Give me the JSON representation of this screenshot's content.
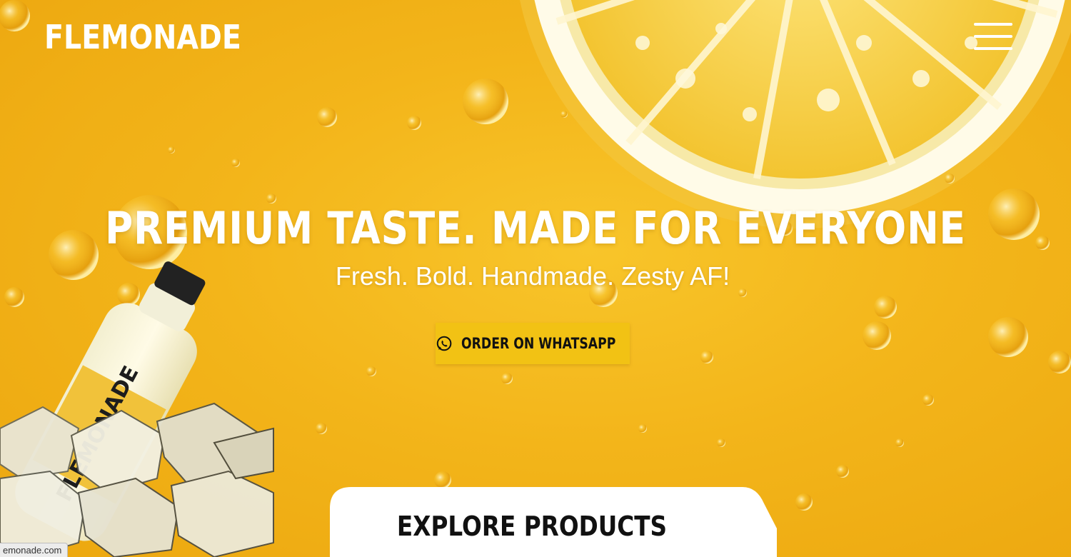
{
  "header": {
    "logo": "FLEMONADE",
    "menu_icon": "hamburger-menu-icon"
  },
  "hero": {
    "headline": "PREMIUM TASTE. MADE FOR EVERYONE",
    "subline": "Fresh. Bold. Handmade. Zesty AF!",
    "cta_label": "ORDER ON WHATSAPP",
    "cta_icon": "whatsapp-icon",
    "bottle_label": "FLEMONADE"
  },
  "products": {
    "label": "EXPLORE PRODUCTS"
  },
  "status_bar": {
    "url": "emonade.com"
  },
  "colors": {
    "background": "#f3b51a",
    "cta": "#f2c214",
    "text_light": "#ffffff",
    "text_dark": "#111111"
  }
}
